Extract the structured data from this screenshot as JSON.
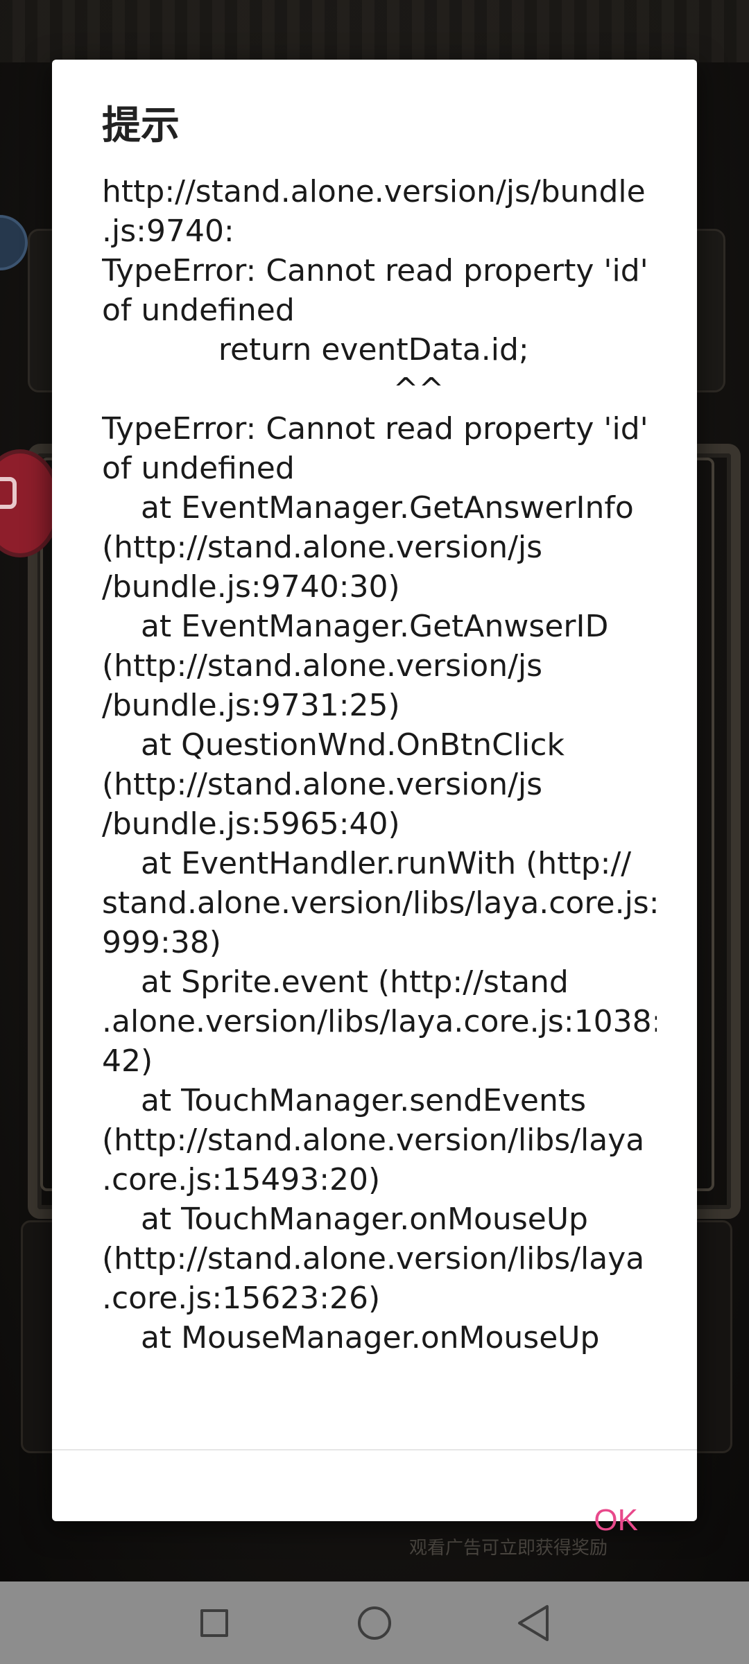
{
  "background": {
    "footer_text": "观看广告可立即获得奖励"
  },
  "dialog": {
    "title": "提示",
    "message_lines": [
      "http://stand.alone.version/js/bundle",
      ".js:9740:",
      "TypeError: Cannot read property 'id'",
      "of undefined",
      "            return eventData.id;",
      "                              ^^",
      "TypeError: Cannot read property 'id'",
      "of undefined",
      "    at EventManager.GetAnswerInfo",
      "(http://stand.alone.version/js",
      "/bundle.js:9740:30)",
      "    at EventManager.GetAnwserID",
      "(http://stand.alone.version/js",
      "/bundle.js:9731:25)",
      "    at QuestionWnd.OnBtnClick",
      "(http://stand.alone.version/js",
      "/bundle.js:5965:40)",
      "    at EventHandler.runWith (http://",
      "stand.alone.version/libs/laya.core.js:",
      "999:38)",
      "    at Sprite.event (http://stand",
      ".alone.version/libs/laya.core.js:1038:",
      "42)",
      "    at TouchManager.sendEvents",
      "(http://stand.alone.version/libs/laya",
      ".core.js:15493:20)",
      "    at TouchManager.onMouseUp",
      "(http://stand.alone.version/libs/laya",
      ".core.js:15623:26)",
      "    at MouseManager.onMouseUp"
    ],
    "ok_label": "OK",
    "ok_color": "#e8498b"
  },
  "nav_bar": {
    "buttons": [
      "recents-icon",
      "home-icon",
      "back-icon"
    ]
  }
}
